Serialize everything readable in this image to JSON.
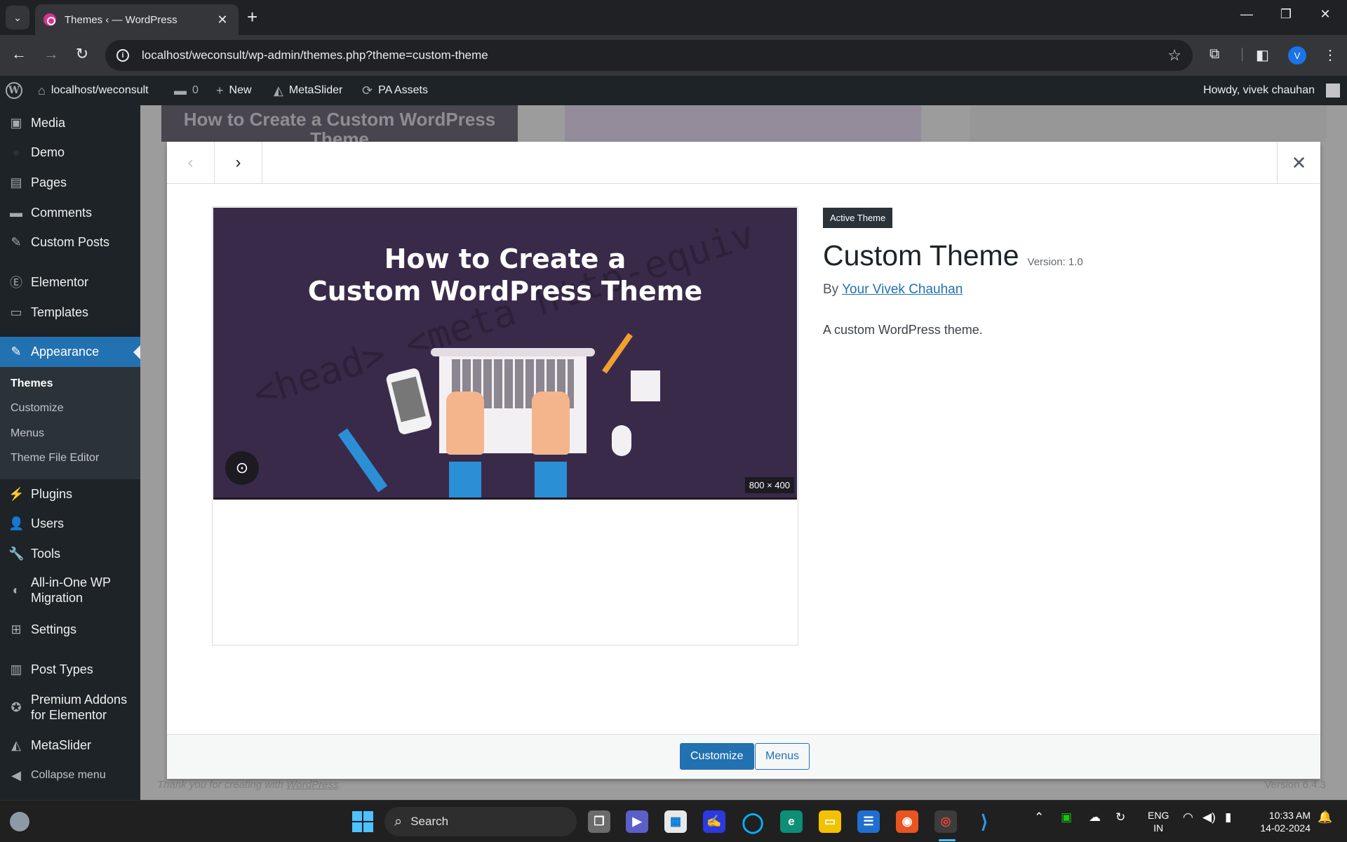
{
  "browser": {
    "tab_title": "Themes ‹ — WordPress",
    "url": "localhost/weconsult/wp-admin/themes.php?theme=custom-theme",
    "profile_initial": "V"
  },
  "adminbar": {
    "site_name": "localhost/weconsult",
    "comments_count": "0",
    "new_label": "New",
    "metaslider_label": "MetaSlider",
    "pa_assets_label": "PA Assets",
    "howdy": "Howdy, vivek chauhan"
  },
  "sidebar": {
    "items": [
      {
        "label": "Media",
        "icon": "media-icon"
      },
      {
        "label": "Demo",
        "icon": "demo-icon"
      },
      {
        "label": "Pages",
        "icon": "pages-icon"
      },
      {
        "label": "Comments",
        "icon": "comments-icon"
      },
      {
        "label": "Custom Posts",
        "icon": "pin-icon"
      },
      {
        "label": "Elementor",
        "icon": "elementor-icon"
      },
      {
        "label": "Templates",
        "icon": "folder-icon"
      },
      {
        "label": "Appearance",
        "icon": "brush-icon"
      },
      {
        "label": "Plugins",
        "icon": "plugin-icon"
      },
      {
        "label": "Users",
        "icon": "user-icon"
      },
      {
        "label": "Tools",
        "icon": "wrench-icon"
      },
      {
        "label": "All-in-One WP Migration",
        "icon": "migration-icon"
      },
      {
        "label": "Settings",
        "icon": "settings-icon"
      },
      {
        "label": "Post Types",
        "icon": "post-types-icon"
      },
      {
        "label": "Premium Addons for Elementor",
        "icon": "star-icon"
      },
      {
        "label": "MetaSlider",
        "icon": "metaslider-icon"
      },
      {
        "label": "Collapse menu",
        "icon": "collapse-icon"
      }
    ],
    "submenu": [
      "Themes",
      "Customize",
      "Menus",
      "Theme File Editor"
    ]
  },
  "background": {
    "card_title": "How to Create a Custom WordPress Theme",
    "footer_text": "Thank you for creating with",
    "footer_link": "WordPress",
    "footer_version": "Version 6.4.3"
  },
  "theme": {
    "screenshot_title_line1": "How to Create a",
    "screenshot_title_line2": "Custom WordPress Theme",
    "screenshot_dims": "800 × 400",
    "active_badge": "Active Theme",
    "name": "Custom Theme",
    "version": "Version: 1.0",
    "author_prefix": "By",
    "author": "Your Vivek Chauhan",
    "description": "A custom WordPress theme.",
    "customize_label": "Customize",
    "menus_label": "Menus"
  },
  "taskbar": {
    "search_label": "Search",
    "lang_line1": "ENG",
    "lang_line2": "IN",
    "time": "10:33 AM",
    "date": "14-02-2024"
  },
  "colors": {
    "wp_blue": "#2271b1",
    "admin_dark": "#1d2327",
    "screenshot_bg": "#3a2a4a"
  }
}
